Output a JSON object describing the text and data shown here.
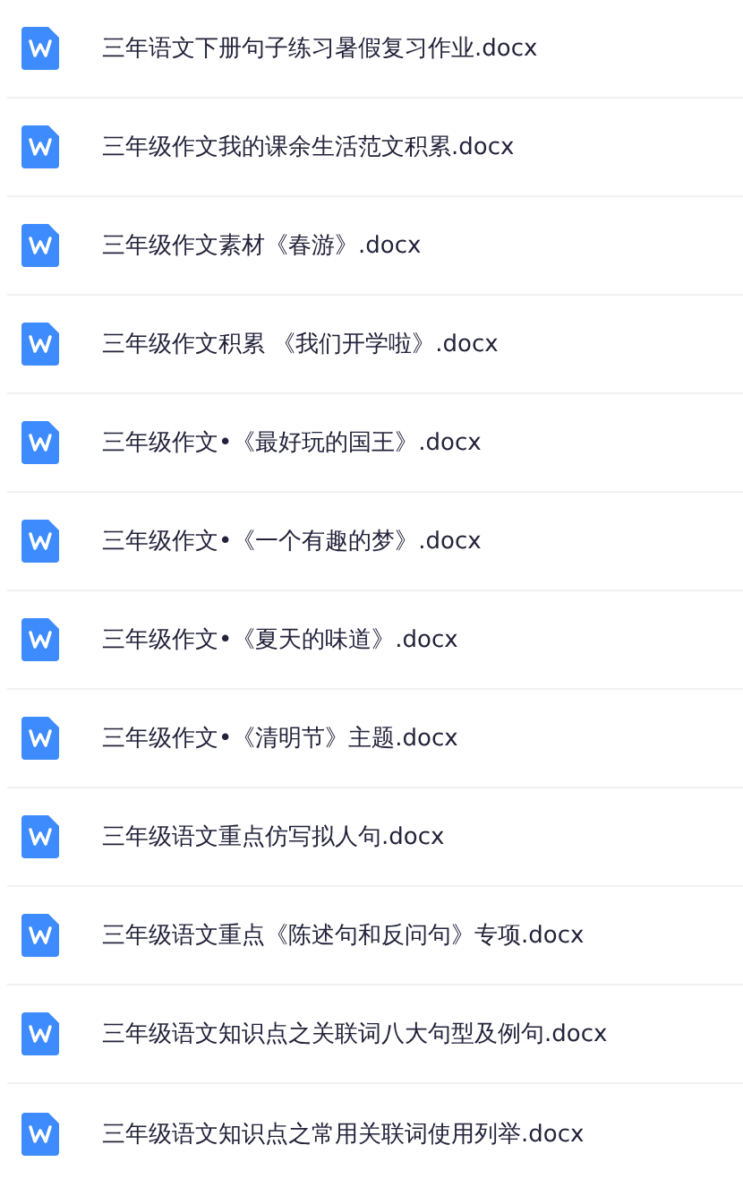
{
  "files": [
    {
      "name": "三年语文下册句子练习暑假复习作业.docx"
    },
    {
      "name": "三年级作文我的课余生活范文积累.docx"
    },
    {
      "name": "三年级作文素材《春游》.docx"
    },
    {
      "name": "三年级作文积累 《我们开学啦》.docx"
    },
    {
      "name": "三年级作文•《最好玩的国王》.docx"
    },
    {
      "name": "三年级作文•《一个有趣的梦》.docx"
    },
    {
      "name": "三年级作文•《夏天的味道》.docx"
    },
    {
      "name": "三年级作文•《清明节》主题.docx"
    },
    {
      "name": "三年级语文重点仿写拟人句.docx"
    },
    {
      "name": "三年级语文重点《陈述句和反问句》专项.docx"
    },
    {
      "name": "三年级语文知识点之关联词八大句型及例句.docx"
    },
    {
      "name": "三年级语文知识点之常用关联词使用列举.docx"
    }
  ]
}
